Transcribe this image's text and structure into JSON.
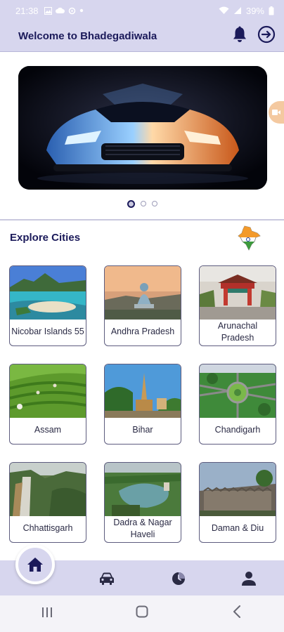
{
  "status_bar": {
    "time": "21:38",
    "battery": "39%",
    "icons": [
      "image-icon",
      "cloud-icon",
      "sync-icon",
      "dot-icon",
      "wifi-icon",
      "signal-icon",
      "battery-icon"
    ]
  },
  "header": {
    "title": "Welcome to Bhadegadiwala",
    "icons": [
      "bell-icon",
      "logout-icon"
    ]
  },
  "banner": {
    "slides": 3,
    "active_slide": 1
  },
  "explore": {
    "title": "Explore Cities"
  },
  "cities": [
    {
      "name": "Nicobar Islands 55"
    },
    {
      "name": "Andhra Pradesh"
    },
    {
      "name": "Arunachal Pradesh"
    },
    {
      "name": "Assam"
    },
    {
      "name": "Bihar"
    },
    {
      "name": "Chandigarh"
    },
    {
      "name": "Chhattisgarh"
    },
    {
      "name": "Dadra & Nagar Haveli"
    },
    {
      "name": "Daman & Diu"
    }
  ],
  "bottom_nav": {
    "items": [
      "home-icon",
      "car-icon",
      "history-icon",
      "profile-icon"
    ],
    "active": "home"
  },
  "colors": {
    "header_bg": "#d7d6ee",
    "brand_text": "#1b1a5a",
    "card_border": "#5d5c7e"
  }
}
